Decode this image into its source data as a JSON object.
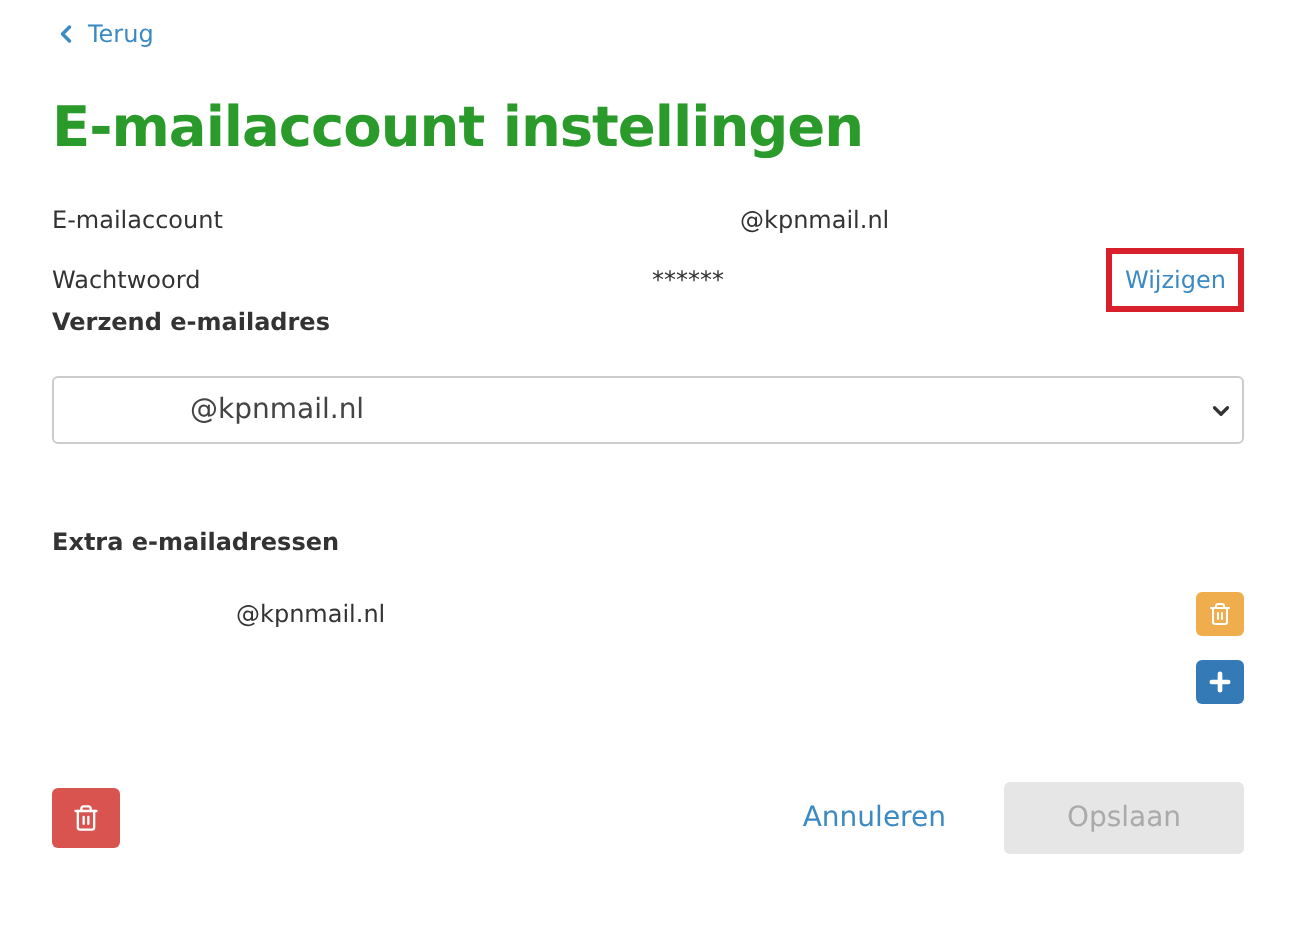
{
  "back_link": {
    "label": "Terug"
  },
  "title": "E-mailaccount instellingen",
  "account_rows": [
    {
      "label": "E-mailaccount",
      "value": "@kpnmail.nl"
    },
    {
      "label": "Wachtwoord",
      "value": "******",
      "action": "Wijzigen",
      "action_highlighted": true
    }
  ],
  "sender": {
    "heading": "Verzend e-mailadres",
    "value": "@kpnmail.nl"
  },
  "extra": {
    "heading": "Extra e-mailadressen",
    "addresses": [
      "@kpnmail.nl"
    ]
  },
  "footer": {
    "cancel": "Annuleren",
    "save": {
      "label": "Opslaan",
      "disabled": true
    }
  }
}
